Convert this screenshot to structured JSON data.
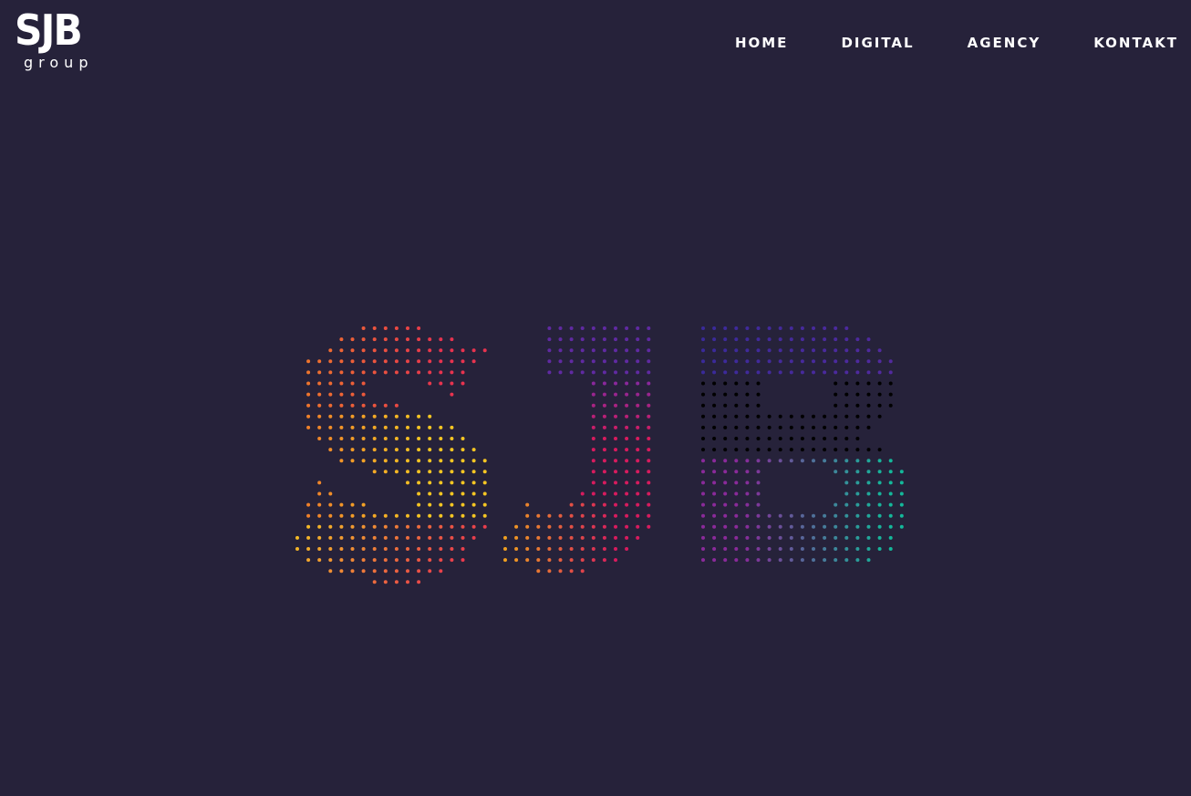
{
  "logo": {
    "main": "SJB",
    "sub": "group"
  },
  "nav": {
    "items": [
      {
        "label": "HOME"
      },
      {
        "label": "DIGITAL"
      },
      {
        "label": "AGENCY"
      },
      {
        "label": "KONTAKT"
      }
    ]
  },
  "hero": {
    "letters": [
      "S",
      "J",
      "B"
    ],
    "colors": {
      "background": "#26223a",
      "text": "#ffffff",
      "s_top": "#e8334f",
      "s_left": "#f07a2a",
      "s_mid": "#f5c623",
      "j_top": "#7a2aa8",
      "j_body": "#d81b5e",
      "j_foot": "#f0a020",
      "b_top": "#3a2a9a",
      "b_mid": "#8a2a9a",
      "b_right": "#14b89a"
    }
  }
}
